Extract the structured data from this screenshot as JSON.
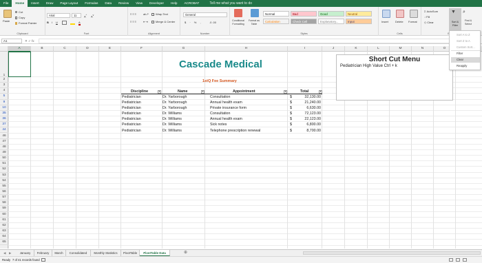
{
  "ribbon_tabs": [
    "File",
    "Home",
    "Insert",
    "Draw",
    "Page Layout",
    "Formulas",
    "Data",
    "Review",
    "View",
    "Developer",
    "Help",
    "ACROBAT"
  ],
  "active_tab": "Home",
  "tell_me": "Tell me what you want to do",
  "clipboard": {
    "paste": "Paste",
    "cut": "Cut",
    "copy": "Copy",
    "format_painter": "Format Painter",
    "label": "Clipboard"
  },
  "font": {
    "name": "Arial",
    "size": "11",
    "label": "Font"
  },
  "alignment": {
    "wrap": "Wrap Text",
    "merge": "Merge & Center",
    "label": "Alignment"
  },
  "number": {
    "format": "General",
    "label": "Number"
  },
  "styles": {
    "conditional": "Conditional Formatting",
    "format_as_table": "Format as Table",
    "cells": [
      {
        "text": "Normal",
        "bg": "#ffffff",
        "color": "#222222"
      },
      {
        "text": "Bad",
        "bg": "#ffc7ce",
        "color": "#9c0006"
      },
      {
        "text": "Good",
        "bg": "#c6efce",
        "color": "#006100"
      },
      {
        "text": "Neutral",
        "bg": "#ffeb9c",
        "color": "#9c5700"
      },
      {
        "text": "Calculation",
        "bg": "#f2f2f2",
        "color": "#fa7d00"
      },
      {
        "text": "Check Cell",
        "bg": "#a5a5a5",
        "color": "#ffffff"
      },
      {
        "text": "Explanatory...",
        "bg": "#ffffff",
        "color": "#7f7f7f"
      },
      {
        "text": "Input",
        "bg": "#ffcc99",
        "color": "#3f3f76"
      }
    ],
    "label": "Styles"
  },
  "cells_group": {
    "insert": "Insert",
    "delete": "Delete",
    "format": "Format",
    "label": "Cells"
  },
  "editing": {
    "autosum": "AutoSum",
    "fill": "Fill",
    "clear": "Clear",
    "sort_filter": "Sort & Filter",
    "find_select": "Find & Select",
    "label": "Editing"
  },
  "sort_menu": [
    {
      "text": "Sort A to Z",
      "state": "disabled"
    },
    {
      "text": "Sort Z to A",
      "state": "disabled"
    },
    {
      "text": "Custom Sort...",
      "state": "disabled"
    },
    {
      "text": "Filter",
      "state": "normal"
    },
    {
      "text": "Clear",
      "state": "hover"
    },
    {
      "text": "Reapply",
      "state": "normal"
    }
  ],
  "name_box": "A1",
  "fx": "fx",
  "columns": [
    "A",
    "B",
    "C",
    "D",
    "E",
    "F",
    "G",
    "H",
    "I",
    "J",
    "K",
    "L",
    "M",
    "N",
    "O"
  ],
  "rows": [
    "1",
    "2",
    "3",
    "4",
    "5",
    "9",
    "10",
    "35",
    "36",
    "37",
    "44",
    "46",
    "47",
    "48",
    "49",
    "50",
    "51",
    "52",
    "53",
    "54",
    "55",
    "56",
    "57",
    "58",
    "59",
    "60",
    "61",
    "62",
    "63",
    "64",
    "65"
  ],
  "sheet_title": "Cascade Medical",
  "sheet_subtitle": "1stQ Fee Summary",
  "table_headers": [
    "Discipline",
    "Name",
    "Appointment",
    "Total"
  ],
  "table_rows": [
    [
      "Pediatrician",
      "Dr. Yarborough",
      "Consultation",
      "$",
      "32,130.00"
    ],
    [
      "Pediatrician",
      "Dr. Yarborough",
      "Annual health exam",
      "$",
      "21,240.00"
    ],
    [
      "Pediatrician",
      "Dr. Yarborough",
      "Private insurance form",
      "$",
      "6,630.00"
    ],
    [
      "Pediatrician",
      "Dr. Williams",
      "Consultation",
      "$",
      "72,123.00"
    ],
    [
      "Pediatrician",
      "Dr. Williams",
      "Annual health exam",
      "$",
      "22,123.00"
    ],
    [
      "Pediatrician",
      "Dr. Williams",
      "Sick notes",
      "$",
      "6,800.00"
    ],
    [
      "Pediatrician",
      "Dr. Williams",
      "Telephone prescription renewal",
      "$",
      "8,700.00"
    ]
  ],
  "shortcut_box": {
    "title": "Short Cut Menu",
    "line": "Pediatrician High Value  Ctrl + k"
  },
  "sheet_tabs": [
    "January",
    "February",
    "March",
    "Consolidated",
    "Monthly Statistics",
    "PivotTable",
    "PivotTable Data"
  ],
  "active_sheet": "PivotTable Data",
  "status": {
    "ready": "Ready",
    "records": "7 of 41 records found"
  }
}
